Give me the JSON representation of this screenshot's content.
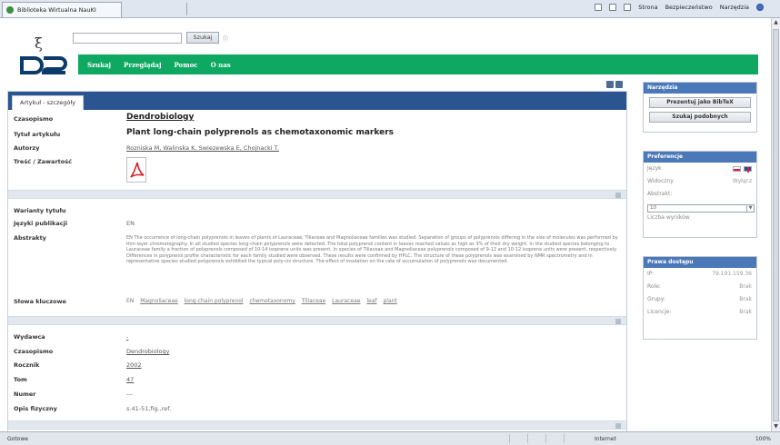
{
  "browser": {
    "tab_title": "Biblioteka Wirtualna NauKI",
    "commands": [
      "Strona",
      "Bezpieczeństwo",
      "Narzędzia"
    ],
    "status_left": "Gotowe",
    "zone": "Internet",
    "zoom": "100%"
  },
  "header": {
    "search_button": "Szukaj",
    "search_extra": "ⓘ"
  },
  "nav": [
    "Szukaj",
    "Przeglądaj",
    "Pomoc",
    "O nas"
  ],
  "main": {
    "tab_label": "Artykuł - szczegóły",
    "fields": {
      "czasopismo_label": "Czasopismo",
      "czasopismo_value": "Dendrobiology",
      "tytul_label": "Tytuł artykułu",
      "tytul_value": "Plant long-chain polyprenols as chemotaxonomic markers",
      "autorzy_label": "Autorzy",
      "autorzy_value": "Rozniska M, Walinska K, Swiezewska E, Chojnacki T.",
      "tresc_label": "Treść / Zawartość",
      "warianty_label": "Warianty tytułu",
      "jezyki_label": "Języki publikacji",
      "jezyki_value": "EN",
      "abstrakty_label": "Abstrakty",
      "abstrakt_text": "EN The occurrence of long-chain polyprenols in leaves of plants of Lauraceae, Tiliaceae and Magnoliaceae families was studied. Separation of groups of polyprenols differing in the size of molecules was performed by thin-layer chromatography. In all studied species long-chain polyprenols were detected. The total polyprenol content in leaves reached values as high as 3% of their dry weight. In the studied species belonging to Lauraceae family a fraction of polyprenols composed of 10-14 isoprene units was present. In species of Tiliaceae and Magnoliaceae polyprenols composed of 9-12 and 10-12 isoprene units were present, respectively. Differences in polyprenol profile characteristic for each family studied were observed. These results were confirmed by HPLC. The structure of these polyprenols was examined by NMR spectrometry and in representative species studied polyprenols exhibited the typical poly-cis structure. The effect of insolation on the rate of accumulation of polyprenols was documented.",
      "slowa_label": "Słowa kluczowe",
      "slowa_lang": "EN",
      "slowa": [
        "Magnoliaceae",
        "long-chain polyprenol",
        "chemotaxonomy",
        "Tiliaceae",
        "Lauraceae",
        "leaf",
        "plant"
      ],
      "wydawca_label": "Wydawca",
      "wydawca_value": "-",
      "czasopismo2_label": "Czasopismo",
      "czasopismo2_value": "Dendrobiology",
      "rocznik_label": "Rocznik",
      "rocznik_value": "2002",
      "tom_label": "Tom",
      "tom_value": "47",
      "numer_label": "Numer",
      "numer_value": "---",
      "opis_label": "Opis fizyczny",
      "opis_value": "s.41-51,fig.,ref."
    }
  },
  "sidebar": {
    "tools_title": "Narzędzia",
    "btn_bibtex": "Prezentuj jako BibTeX",
    "btn_similar": "Szukaj podobnych",
    "pref_title": "Preferencje",
    "pref_lang": "Język",
    "pref_widok": "Widoczny",
    "pref_widok_value": "Wyłącz",
    "pref_abstrakt": "Abstrakt:",
    "pref_count": "10",
    "pref_count_label": "Liczba wyników",
    "access_title": "Prawa dostępu",
    "access_ip_label": "IP:",
    "access_ip_value": "79.191.159.36",
    "access_rola_label": "Role:",
    "access_rola_value": "Brak",
    "access_grupy_label": "Grupy:",
    "access_grupy_value": "Brak",
    "access_licencje_label": "Licencje:",
    "access_licencje_value": "Brak"
  }
}
